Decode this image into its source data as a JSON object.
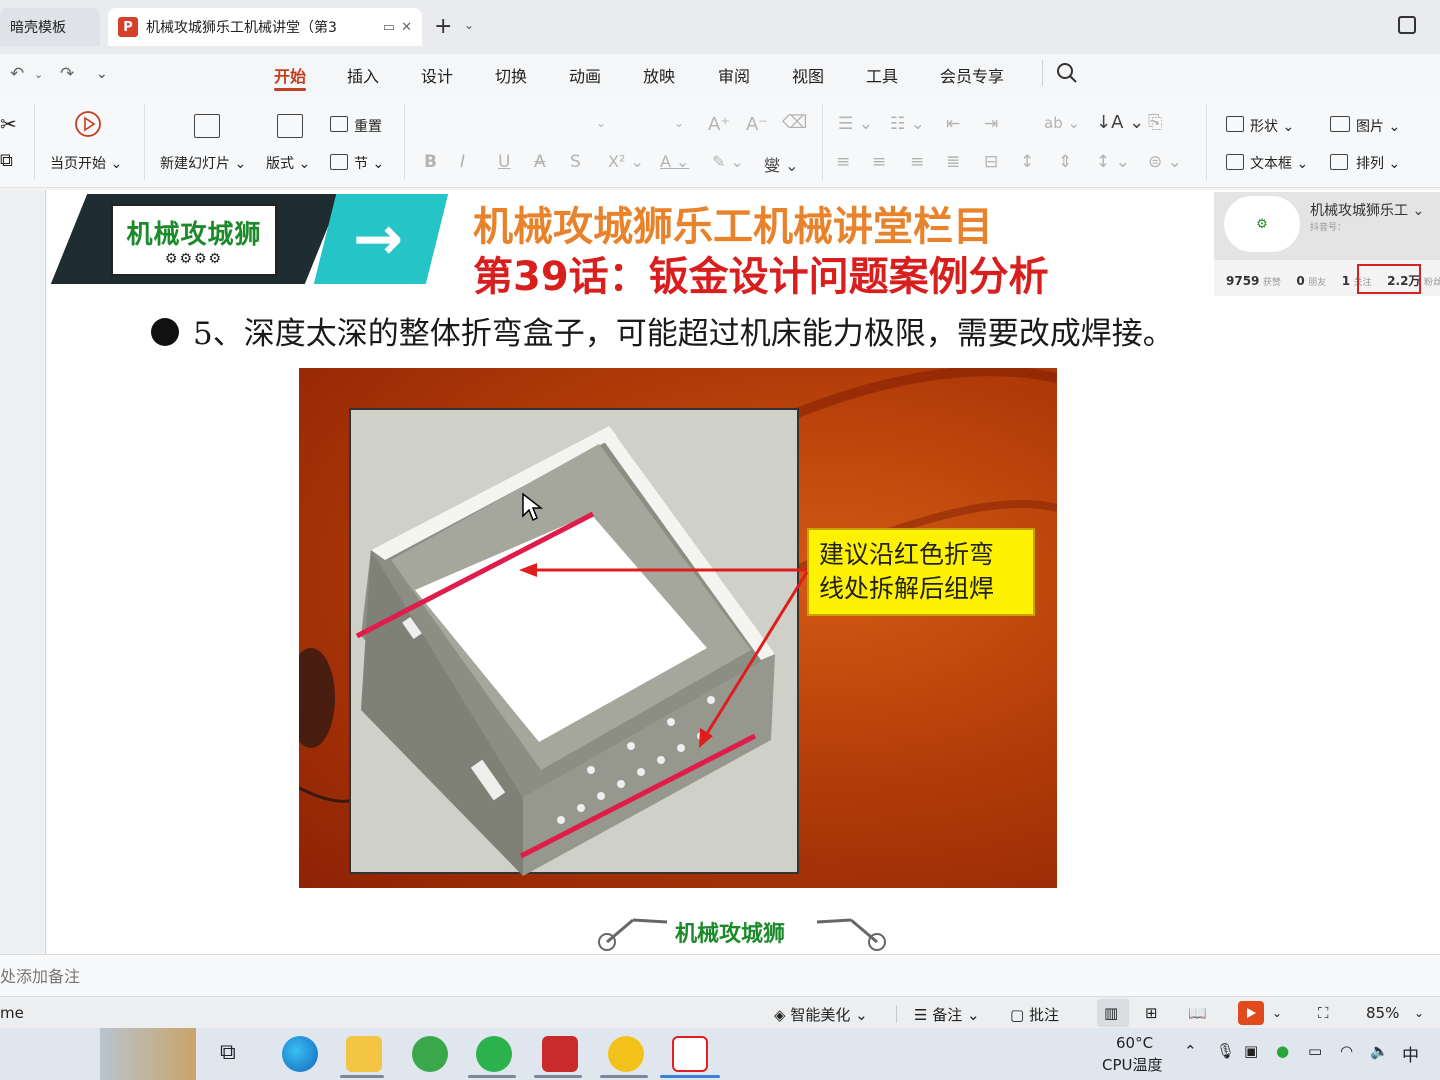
{
  "titlebar": {
    "prev_tab": "暗壳模板",
    "active_tab": "机械攻城狮乐工机械讲堂（第3",
    "new_tab": "+"
  },
  "menu": {
    "items": [
      "开始",
      "插入",
      "设计",
      "切换",
      "动画",
      "放映",
      "审阅",
      "视图",
      "工具",
      "会员专享"
    ],
    "active": "开始"
  },
  "ribbon": {
    "play_from_current": "当页开始",
    "new_slide": "新建幻灯片",
    "layout": "版式",
    "reset": "重置",
    "section": "节",
    "shape": "形状",
    "picture": "图片",
    "textbox": "文本框",
    "arrange": "排列"
  },
  "slide": {
    "logo": "机械攻城狮",
    "title_line1": "机械攻城狮乐工机械讲堂栏目",
    "title_line2": "第39话：钣金设计问题案例分析",
    "bullet": "5、深度太深的整体折弯盒子，可能超过机床能力极限，需要改成焊接。",
    "callout_line1": "建议沿红色折弯",
    "callout_line2": "线处拆解后组焊",
    "footer_logo": "机械攻城狮"
  },
  "profile": {
    "name": "机械攻城狮乐工",
    "sub": "抖音号：",
    "likes": "9759",
    "likes_label": "获赞",
    "friends": "0",
    "friends_label": "朋友",
    "following": "1",
    "following_label": "关注",
    "fans": "2.2万",
    "fans_label": "粉丝"
  },
  "notes": {
    "placeholder": "处添加备注"
  },
  "statusbar": {
    "left": "me",
    "smart_beautify": "智能美化",
    "notes_btn": "备注",
    "comment_btn": "批注",
    "zoom": "85%"
  },
  "taskbar": {
    "temp": "60°C",
    "temp_label": "CPU温度",
    "ime": "中"
  },
  "colors": {
    "accent": "#c43f1f",
    "title_orange": "#e8822b",
    "title_red": "#d91e1e",
    "callout_yellow": "#fff200",
    "fold_line": "#e01c4a"
  }
}
